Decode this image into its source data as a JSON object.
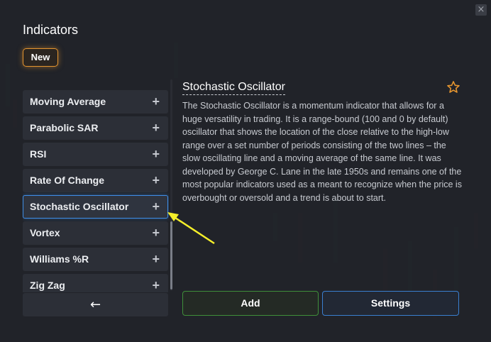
{
  "header": {
    "title": "Indicators",
    "new_badge": "New",
    "close_label": "×"
  },
  "indicators": [
    {
      "label": "Moving Average",
      "add": "+"
    },
    {
      "label": "Parabolic SAR",
      "add": "+"
    },
    {
      "label": "RSI",
      "add": "+"
    },
    {
      "label": "Rate Of Change",
      "add": "+"
    },
    {
      "label": "Stochastic Oscillator",
      "add": "+",
      "selected": true
    },
    {
      "label": "Vortex",
      "add": "+"
    },
    {
      "label": "Williams %R",
      "add": "+"
    },
    {
      "label": "Zig Zag",
      "add": "+"
    }
  ],
  "back_label": "←",
  "detail": {
    "title": "Stochastic Oscillator",
    "favorite_icon": "star-outline-icon",
    "description": "The Stochastic Oscillator is a momentum indicator that allows for a huge versatility in trading. It is a range-bound (100 and 0 by default) oscillator that shows the location of the close relative to the high-low range over a set number of periods consisting of the two lines – the slow oscillating line and a moving average of the same line. It was developed by George C. Lane in the late 1950s and remains one of the most popular indicators used as a meant to recognize when the price is overbought or oversold and a trend is about to start."
  },
  "actions": {
    "add_label": "Add",
    "settings_label": "Settings"
  },
  "colors": {
    "accent_orange": "#e5952f",
    "accent_blue": "#3f8ee8",
    "accent_green": "#3f8f3a",
    "annotation_arrow": "#f5ef2a"
  }
}
